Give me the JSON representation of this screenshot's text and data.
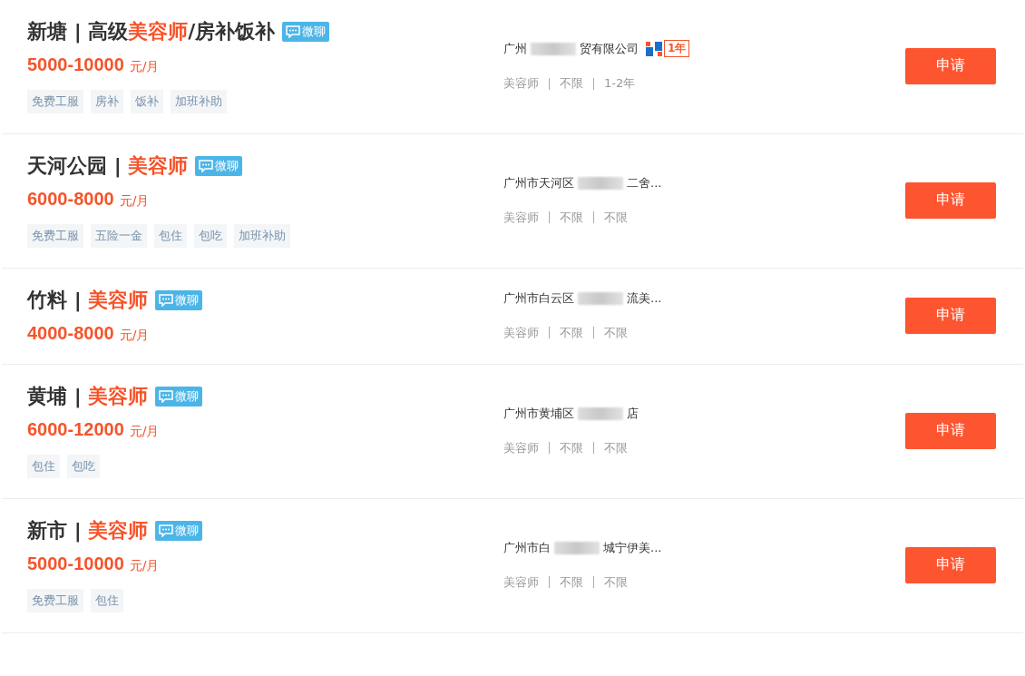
{
  "jobs": [
    {
      "title": [
        {
          "text": "新塘 | 高级",
          "accent": false
        },
        {
          "text": "美容师",
          "accent": true
        },
        {
          "text": "/房补饭补",
          "accent": false
        }
      ],
      "chat_badge": "微聊",
      "salary": "5000-10000",
      "salary_unit": "元/月",
      "tags": [
        "免费工服",
        "房补",
        "饭补",
        "加班补助"
      ],
      "company": {
        "before_blur": "广州",
        "after_blur": "贸有限公司",
        "member_years": "1年"
      },
      "meta": [
        "美容师",
        "不限",
        "1-2年"
      ],
      "apply": "申请"
    },
    {
      "title": [
        {
          "text": "天河公园 | ",
          "accent": false
        },
        {
          "text": "美容师",
          "accent": true
        }
      ],
      "chat_badge": "微聊",
      "salary": "6000-8000",
      "salary_unit": "元/月",
      "tags": [
        "免费工服",
        "五险一金",
        "包住",
        "包吃",
        "加班补助"
      ],
      "company": {
        "before_blur": "广州市天河区",
        "after_blur": "二舍..."
      },
      "meta": [
        "美容师",
        "不限",
        "不限"
      ],
      "apply": "申请"
    },
    {
      "title": [
        {
          "text": "竹料 | ",
          "accent": false
        },
        {
          "text": "美容师",
          "accent": true
        }
      ],
      "chat_badge": "微聊",
      "salary": "4000-8000",
      "salary_unit": "元/月",
      "company": {
        "before_blur": "广州市白云区",
        "after_blur": "流美..."
      },
      "meta": [
        "美容师",
        "不限",
        "不限"
      ],
      "apply": "申请"
    },
    {
      "title": [
        {
          "text": "黄埔 | ",
          "accent": false
        },
        {
          "text": "美容师",
          "accent": true
        }
      ],
      "chat_badge": "微聊",
      "salary": "6000-12000",
      "salary_unit": "元/月",
      "tags": [
        "包住",
        "包吃"
      ],
      "company": {
        "before_blur": "广州市黄埔区",
        "after_blur": "店"
      },
      "meta": [
        "美容师",
        "不限",
        "不限"
      ],
      "apply": "申请"
    },
    {
      "title": [
        {
          "text": "新市 | ",
          "accent": false
        },
        {
          "text": "美容师",
          "accent": true
        }
      ],
      "chat_badge": "微聊",
      "salary": "5000-10000",
      "salary_unit": "元/月",
      "tags": [
        "免费工服",
        "包住"
      ],
      "company": {
        "before_blur": "广州市白",
        "after_blur": "城宁伊美..."
      },
      "meta": [
        "美容师",
        "不限",
        "不限"
      ],
      "apply": "申请"
    }
  ]
}
